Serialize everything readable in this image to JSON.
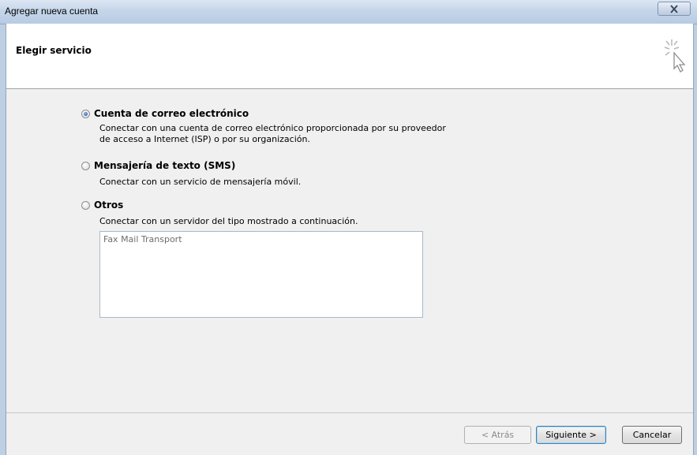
{
  "window": {
    "title": "Agregar nueva cuenta"
  },
  "header": {
    "title": "Elegir servicio",
    "icon": "magic-wand-cursor-icon"
  },
  "options": [
    {
      "label": "Cuenta de correo electrónico",
      "checked": true,
      "description_line1": "Conectar con una cuenta de correo electrónico proporcionada por su proveedor",
      "description_line2": "de acceso a Internet (ISP) o por su organización."
    },
    {
      "label": "Mensajería de texto (SMS)",
      "checked": false,
      "description_line1": "Conectar con un servicio de mensajería móvil."
    },
    {
      "label": "Otros",
      "checked": false,
      "description_line1": "Conectar con un servidor del tipo mostrado a continuación."
    }
  ],
  "other_types": {
    "items": [
      "Fax Mail Transport"
    ]
  },
  "buttons": {
    "back": "< Atrás",
    "next": "Siguiente >",
    "cancel": "Cancelar"
  }
}
